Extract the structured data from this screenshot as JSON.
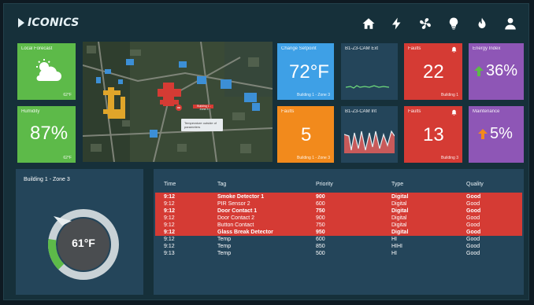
{
  "header": {
    "logo_text": "ICONICS",
    "nav_icons": [
      "home-icon",
      "bolt-icon",
      "fan-icon",
      "lightbulb-icon",
      "flame-icon",
      "user-icon"
    ]
  },
  "tiles": {
    "local_forecast": {
      "label": "Local Forecast",
      "foot": "62°F"
    },
    "humidity": {
      "label": "Humidity",
      "value": "87%",
      "foot": "62°F"
    },
    "change_setpoint": {
      "label": "Change Setpoint",
      "value": "72°F",
      "foot": "Building 1 - Zone 3"
    },
    "cam_ext": {
      "label": "B1-Z3-CAM Ext"
    },
    "faults_1": {
      "label": "Faults",
      "value": "22",
      "foot": "Building 1"
    },
    "energy_index": {
      "label": "Energy Index",
      "value": "36%"
    },
    "faults_2": {
      "label": "Faults",
      "value": "5",
      "foot": "Building 1 - Zone 3"
    },
    "cam_int": {
      "label": "B1-Z3-CAM Int"
    },
    "faults_3": {
      "label": "Faults",
      "value": "13",
      "foot": "Building 3"
    },
    "maintenance": {
      "label": "Maintenance",
      "value": "5%"
    }
  },
  "map": {
    "tooltip": "Temperature outside of parameters",
    "label": "Building 1 - Zone 3"
  },
  "building_panel": {
    "title": "Building 1 - Zone 3",
    "temperature": "61°F",
    "gauge_level": 0.15
  },
  "alarm_table": {
    "headers": [
      "Time",
      "Tag",
      "Priority",
      "Type",
      "Quality"
    ],
    "rows": [
      {
        "time": "9:12",
        "tag": "Smoke Detector 1",
        "priority": "900",
        "type": "Digital",
        "quality": "Good",
        "alarm": true,
        "bold": true
      },
      {
        "time": "9:12",
        "tag": "PIR Sensor 2",
        "priority": "600",
        "type": "Digital",
        "quality": "Good",
        "alarm": true,
        "bold": false
      },
      {
        "time": "9:12",
        "tag": "Door Contact 1",
        "priority": "750",
        "type": "Digital",
        "quality": "Good",
        "alarm": true,
        "bold": true
      },
      {
        "time": "9:12",
        "tag": "Door Contact 2",
        "priority": "900",
        "type": "Digital",
        "quality": "Good",
        "alarm": true,
        "bold": false
      },
      {
        "time": "9:12",
        "tag": "Button Contact",
        "priority": "750",
        "type": "Digital",
        "quality": "Good",
        "alarm": true,
        "bold": false
      },
      {
        "time": "9:12",
        "tag": "Glass Break Detector",
        "priority": "950",
        "type": "Digital",
        "quality": "Good",
        "alarm": true,
        "bold": true
      },
      {
        "time": "9:12",
        "tag": "Temp",
        "priority": "600",
        "type": "HI",
        "quality": "Good",
        "alarm": false,
        "bold": false
      },
      {
        "time": "9:12",
        "tag": "Temp",
        "priority": "850",
        "type": "HIHI",
        "quality": "Good",
        "alarm": false,
        "bold": false
      },
      {
        "time": "9:13",
        "tag": "Temp",
        "priority": "500",
        "type": "HI",
        "quality": "Good",
        "alarm": false,
        "bold": false
      }
    ]
  },
  "colors": {
    "green": "#5dba49",
    "blue": "#3ea0e6",
    "orange": "#f28a1c",
    "red": "#d53b34",
    "purple": "#8e56b6",
    "dark": "#24455a"
  }
}
